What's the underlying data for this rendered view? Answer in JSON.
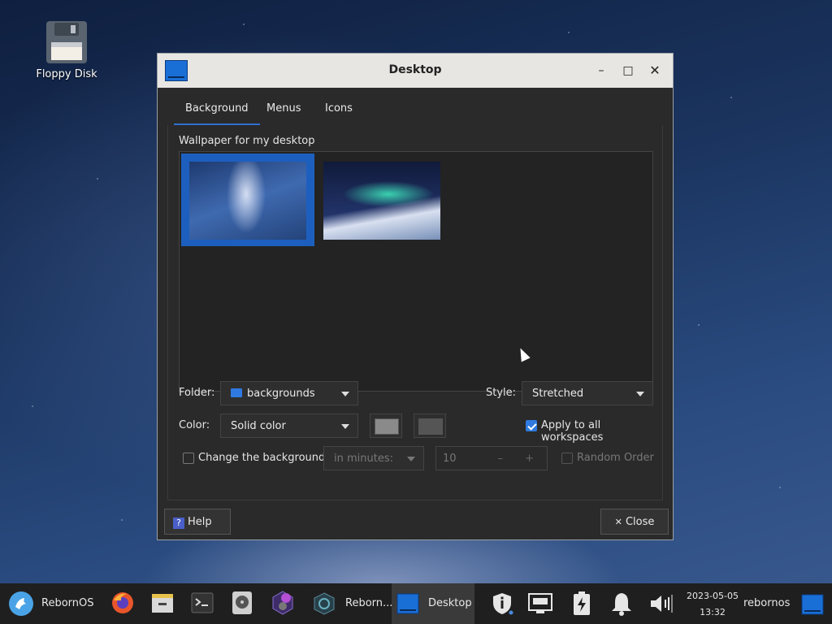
{
  "desktop": {
    "icons": [
      {
        "label": "Floppy Disk",
        "icon": "floppy-disk-icon"
      }
    ]
  },
  "window": {
    "title": "Desktop",
    "controls": {
      "minimize": "–",
      "maximize": "□",
      "close": "✕"
    },
    "tabs": [
      {
        "label": "Background",
        "active": true
      },
      {
        "label": "Menus",
        "active": false
      },
      {
        "label": "Icons",
        "active": false
      }
    ],
    "background": {
      "wallpaper_label": "Wallpaper for my desktop",
      "folder_label": "Folder:",
      "folder_value": "backgrounds",
      "style_label": "Style:",
      "style_value": "Stretched",
      "color_label": "Color:",
      "color_value": "Solid color",
      "color_swatch_1": "#8a8a8a",
      "color_swatch_2": "#555555",
      "apply_all_label": "Apply to all workspaces",
      "apply_all_checked": true,
      "change_bg_label": "Change the background",
      "change_bg_checked": false,
      "interval_unit": "in minutes:",
      "interval_value": "10",
      "interval_minus": "–",
      "interval_plus": "+",
      "random_order_label": "Random Order",
      "random_order_checked": false
    },
    "buttons": {
      "help": "Help",
      "help_icon": "?",
      "close": "Close",
      "close_icon": "✕"
    }
  },
  "taskbar": {
    "start_label": "RebornOS",
    "apps": [
      {
        "icon": "firefox-icon"
      },
      {
        "icon": "file-manager-icon"
      },
      {
        "icon": "terminal-icon"
      },
      {
        "icon": "disk-utility-icon"
      },
      {
        "icon": "welcome-app-icon"
      }
    ],
    "tasks": [
      {
        "label": "Reborn...",
        "active": false
      },
      {
        "label": "Desktop",
        "active": true
      }
    ],
    "tray_icons": [
      "security-icon",
      "network-icon",
      "power-icon",
      "notifications-icon",
      "volume-icon"
    ],
    "date": "2023-05-05",
    "time": "13:32",
    "user": "rebornos"
  },
  "colors": {
    "accent": "#2f6fd0",
    "selection": "#1d5fbf",
    "window_bg": "#2a2a2a",
    "titlebar": "#e8e6e3"
  }
}
